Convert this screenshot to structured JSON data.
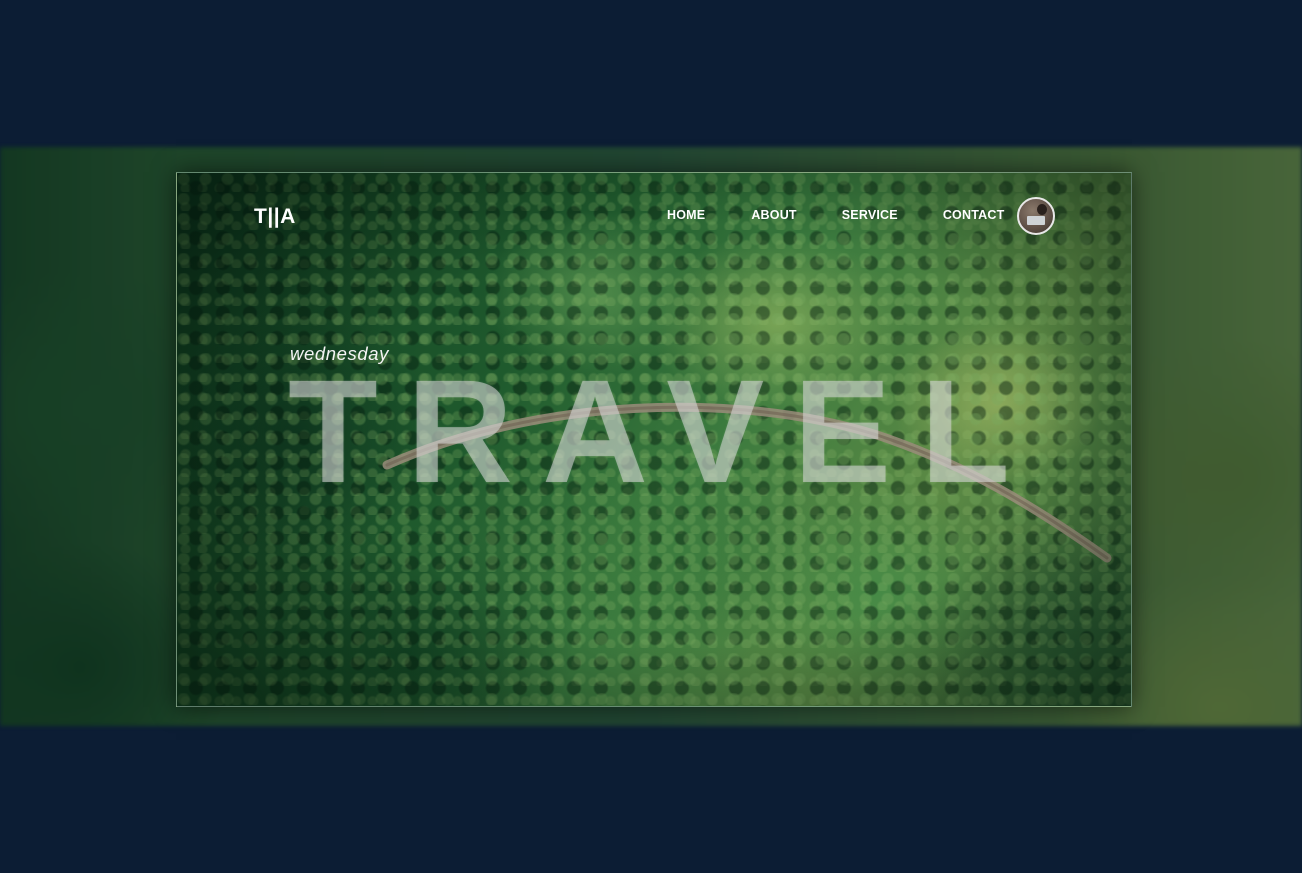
{
  "brand": {
    "logo": "T||A"
  },
  "nav": {
    "items": [
      {
        "label": "HOME"
      },
      {
        "label": "ABOUT"
      },
      {
        "label": "SERVICE"
      },
      {
        "label": "CONTACT"
      }
    ],
    "avatar_icon": "user-avatar"
  },
  "hero": {
    "day": "wednesday",
    "headline": "TRAVEL",
    "background": "aerial forest with curved road"
  },
  "colors": {
    "page_background": "#0c1d34",
    "text": "#ffffff",
    "headline_overlay": "rgba(215,215,215,0.55)"
  }
}
